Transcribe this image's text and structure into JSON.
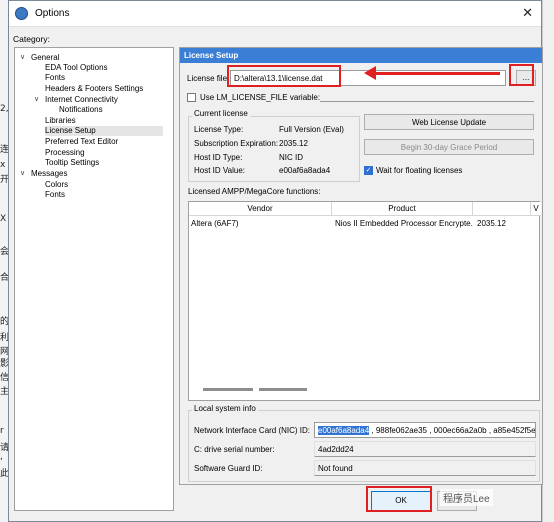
{
  "background": {
    "left_chars": [
      "2,",
      "连",
      "x",
      "开",
      "X",
      "会",
      "合",
      "的",
      "利",
      "网",
      "影",
      "信",
      "主",
      "r",
      "请",
      ",",
      "此"
    ]
  },
  "window": {
    "title": "Options",
    "close_icon": "✕",
    "category_label": "Category:"
  },
  "tree": [
    {
      "label": "General",
      "toggle": "∨"
    },
    {
      "label": "EDA Tool Options"
    },
    {
      "label": "Fonts"
    },
    {
      "label": "Headers & Footers Settings"
    },
    {
      "label": "Internet Connectivity",
      "toggle": "∨"
    },
    {
      "label": "Notifications"
    },
    {
      "label": "Libraries"
    },
    {
      "label": "License Setup",
      "selected": true
    },
    {
      "label": "Preferred Text Editor"
    },
    {
      "label": "Processing"
    },
    {
      "label": "Tooltip Settings"
    },
    {
      "label": "Messages",
      "toggle": "∨"
    },
    {
      "label": "Colors"
    },
    {
      "label": "Fonts"
    }
  ],
  "license_setup": {
    "header": "License Setup",
    "license_file_label": "License file:",
    "license_file_value": "D:\\altera\\13.1\\license.dat",
    "browse_label": "...",
    "use_env_label": "Use LM_LICENSE_FILE variable:",
    "current_license": {
      "group_label": "Current license",
      "rows": [
        {
          "label": "License Type:",
          "value": "Full Version (Eval)"
        },
        {
          "label": "Subscription Expiration:",
          "value": "2035.12"
        },
        {
          "label": "Host ID Type:",
          "value": "NIC ID"
        },
        {
          "label": "Host ID Value:",
          "value": "e00af6a8ada4"
        }
      ]
    },
    "web_update_button": "Web License Update",
    "grace_button": "Begin 30-day Grace Period",
    "wait_floating_label": "Wait for floating licenses",
    "functions_label": "Licensed AMPP/MegaCore functions:",
    "table": {
      "headers": [
        "Vendor",
        "Product",
        "",
        "V"
      ],
      "rows": [
        [
          "Altera (6AF7)",
          "Nios II Embedded Processor Encrypte...",
          "2035.12",
          ""
        ]
      ]
    },
    "local_info": {
      "group_label": "Local system info",
      "nic_label": "Network Interface Card (NIC) ID:",
      "nic_selected": "e00af6a8ada4",
      "nic_rest": " , 988fe062ae35 , 000ec66a2a0b , a85e452f5e",
      "drive_label": "C: drive serial number:",
      "drive_value": "4ad2dd24",
      "sgd_label": "Software Guard ID:",
      "sgd_value": "Not found"
    }
  },
  "footer": {
    "ok_label": "OK",
    "cancel_label": "Ca"
  },
  "watermark": "程序员Lee",
  "colors": {
    "header": "#3a7fd5",
    "annotation": "#e02020",
    "selection": "#3173d1"
  }
}
